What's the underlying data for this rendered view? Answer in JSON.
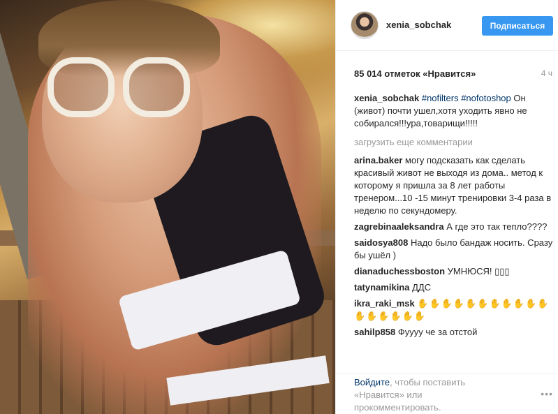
{
  "post": {
    "username": "xenia_sobchak",
    "follow_label": "Подписаться",
    "likes": "85 014 отметок «Нравится»",
    "time": "4 ч"
  },
  "caption": {
    "username": "xenia_sobchak",
    "tags": "#nofilters #nofotoshop",
    "text": "Он (живот) почти ушел,хотя уходить явно не собирался!!!ура,товарищи!!!!!"
  },
  "load_more": "загрузить еще комментарии",
  "comments": [
    {
      "user": "arina.baker",
      "text": "могу подсказать как сделать красивый живот не выходя из дома.. метод к которому я пришла за 8 лет работы тренером...10 -15 минут тренировки 3-4 раза в неделю по секундомеру."
    },
    {
      "user": "zagrebinaaleksandra",
      "text": "А где это так тепло????"
    },
    {
      "user": "saidosya808",
      "text": "Надо было бандаж носить. Сразу бы ушёл )"
    },
    {
      "user": "dianaduchessboston",
      "text": "УМНЮСЯ! ▯▯▯"
    },
    {
      "user": "tatynamikina",
      "text": "ДДС"
    },
    {
      "user": "ikra_raki_msk",
      "text": "✋✋✋✋✋✋✋✋✋✋✋✋✋✋✋✋✋"
    },
    {
      "user": "sahilp858",
      "text": "Фуууу че за отстой"
    }
  ],
  "footer": {
    "login_link": "Войдите",
    "login_text": ", чтобы поставить «Нравится» или прокомментировать.",
    "more_icon": "•••"
  },
  "icons": {
    "avatar": "avatar-image",
    "more": "more-options-icon"
  },
  "colors": {
    "button": "#3897f0",
    "link": "#003569",
    "muted": "#999999"
  }
}
